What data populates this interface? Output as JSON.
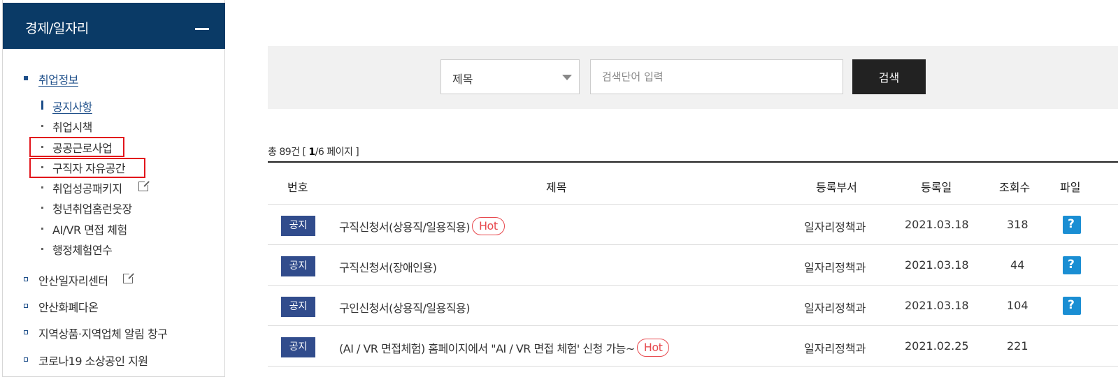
{
  "sidebar": {
    "title": "경제/일자리",
    "menu": [
      {
        "label": "취업정보",
        "active": true,
        "external": false
      },
      {
        "label": "안산일자리센터",
        "active": false,
        "external": true
      },
      {
        "label": "안산화폐다온",
        "active": false,
        "external": false
      },
      {
        "label": "지역상품·지역업체 알림 창구",
        "active": false,
        "external": false
      },
      {
        "label": "코로나19 소상공인 지원",
        "active": false,
        "external": false
      }
    ],
    "submenu": [
      {
        "label": "공지사항",
        "active": true
      },
      {
        "label": "취업시책",
        "active": false
      },
      {
        "label": "공공근로사업",
        "active": false,
        "highlighted": true
      },
      {
        "label": "구직자 자유공간",
        "active": false,
        "highlighted": true
      },
      {
        "label": "취업성공패키지",
        "active": false,
        "external": true
      },
      {
        "label": "청년취업홈런웃장",
        "active": false
      },
      {
        "label": "AI/VR 면접 체험",
        "active": false
      },
      {
        "label": "행정체험연수",
        "active": false
      }
    ]
  },
  "search": {
    "select_value": "제목",
    "placeholder": "검색단어 입력",
    "button_label": "검색"
  },
  "count": {
    "prefix": "총 89건 [",
    "current_page": "1",
    "suffix": "/6 페이지 ]"
  },
  "table": {
    "headers": [
      "번호",
      "제목",
      "등록부서",
      "등록일",
      "조회수",
      "파일"
    ],
    "rows": [
      {
        "badge": "공지",
        "title": "구직신청서(상용직/일용직용)",
        "hot": "Hot",
        "dept": "일자리정책과",
        "date": "2021.03.18",
        "views": "318",
        "file": true
      },
      {
        "badge": "공지",
        "title": "구직신청서(장애인용)",
        "hot": "",
        "dept": "일자리정책과",
        "date": "2021.03.18",
        "views": "44",
        "file": true
      },
      {
        "badge": "공지",
        "title": "구인신청서(상용직/일용직용)",
        "hot": "",
        "dept": "일자리정책과",
        "date": "2021.03.18",
        "views": "104",
        "file": true
      },
      {
        "badge": "공지",
        "title": "(AI / VR 면접체험) 홈페이지에서 \"AI / VR 면접 체험' 신청 가능~",
        "hot": "Hot",
        "dept": "일자리정책과",
        "date": "2021.02.25",
        "views": "221",
        "file": false
      }
    ]
  },
  "colors": {
    "sidebar_header": "#0a3a66",
    "accent": "#1d4e89",
    "badge": "#314c8c",
    "hot": "#e7494e",
    "highlight_box": "#e2141b",
    "file_icon": "#1a8ed3"
  }
}
